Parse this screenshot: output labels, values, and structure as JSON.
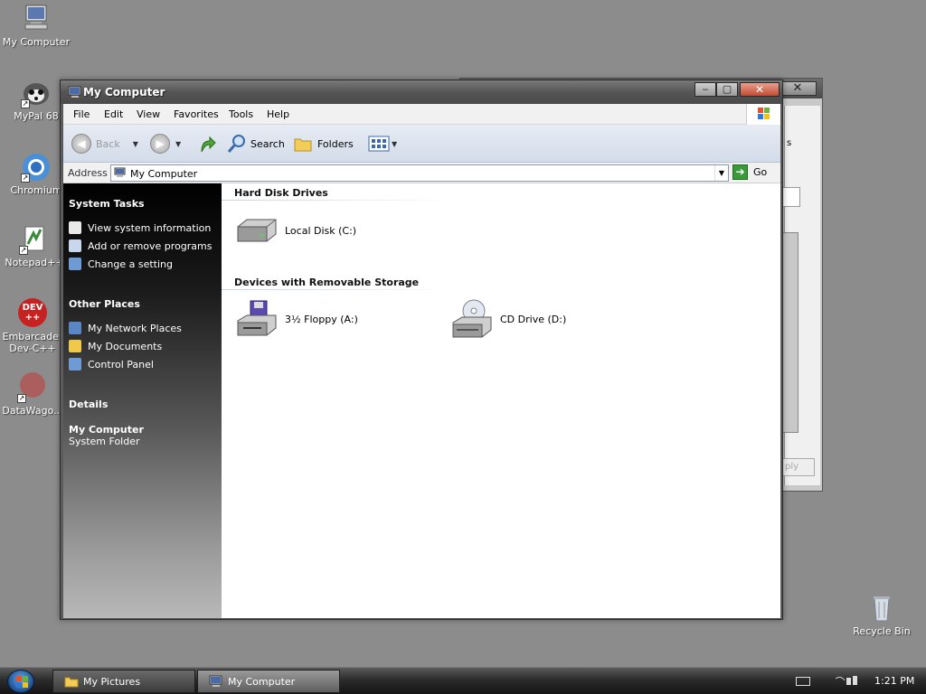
{
  "desktop": {
    "icons": [
      {
        "label": "My Computer"
      },
      {
        "label": "MyPal 68"
      },
      {
        "label": "Chromium"
      },
      {
        "label": "Notepad++"
      },
      {
        "label": "Embarcadero Dev-C++",
        "label_line1": "Embarcader",
        "label_line2": "Dev-C++",
        "badge": "DEV",
        "badge2": "++"
      },
      {
        "label": "DataWago..."
      },
      {
        "label": "Recycle Bin"
      }
    ]
  },
  "background_window": {
    "close_glyph": "✕",
    "button_label": "ply",
    "fragment": "s"
  },
  "window": {
    "title": "My Computer",
    "controls": {
      "minimize": "‒",
      "maximize": "▢",
      "close": "✕"
    },
    "menu": [
      "File",
      "Edit",
      "View",
      "Favorites",
      "Tools",
      "Help"
    ],
    "toolbar": {
      "back": "Back",
      "search": "Search",
      "folders": "Folders"
    },
    "address": {
      "label": "Address",
      "value": "My Computer",
      "go": "Go"
    },
    "tasks": {
      "system_tasks": {
        "title": "System Tasks",
        "items": [
          "View system information",
          "Add or remove programs",
          "Change a setting"
        ]
      },
      "other_places": {
        "title": "Other Places",
        "items": [
          "My Network Places",
          "My Documents",
          "Control Panel"
        ]
      },
      "details": {
        "title": "Details",
        "name": "My Computer",
        "type": "System Folder"
      }
    },
    "content": {
      "groups": [
        {
          "title": "Hard Disk Drives",
          "items": [
            "Local Disk (C:)"
          ]
        },
        {
          "title": "Devices with Removable Storage",
          "items": [
            "3½ Floppy (A:)",
            "CD Drive (D:)"
          ]
        }
      ]
    }
  },
  "taskbar": {
    "buttons": [
      {
        "label": "My Pictures",
        "active": false
      },
      {
        "label": "My Computer",
        "active": true
      }
    ],
    "clock": "1:21 PM"
  },
  "colors": {
    "desktop": "#8c8c8c",
    "task_pane_top": "#000000",
    "toolbar": "#dde3ee",
    "go_green": "#3a9a3a"
  }
}
